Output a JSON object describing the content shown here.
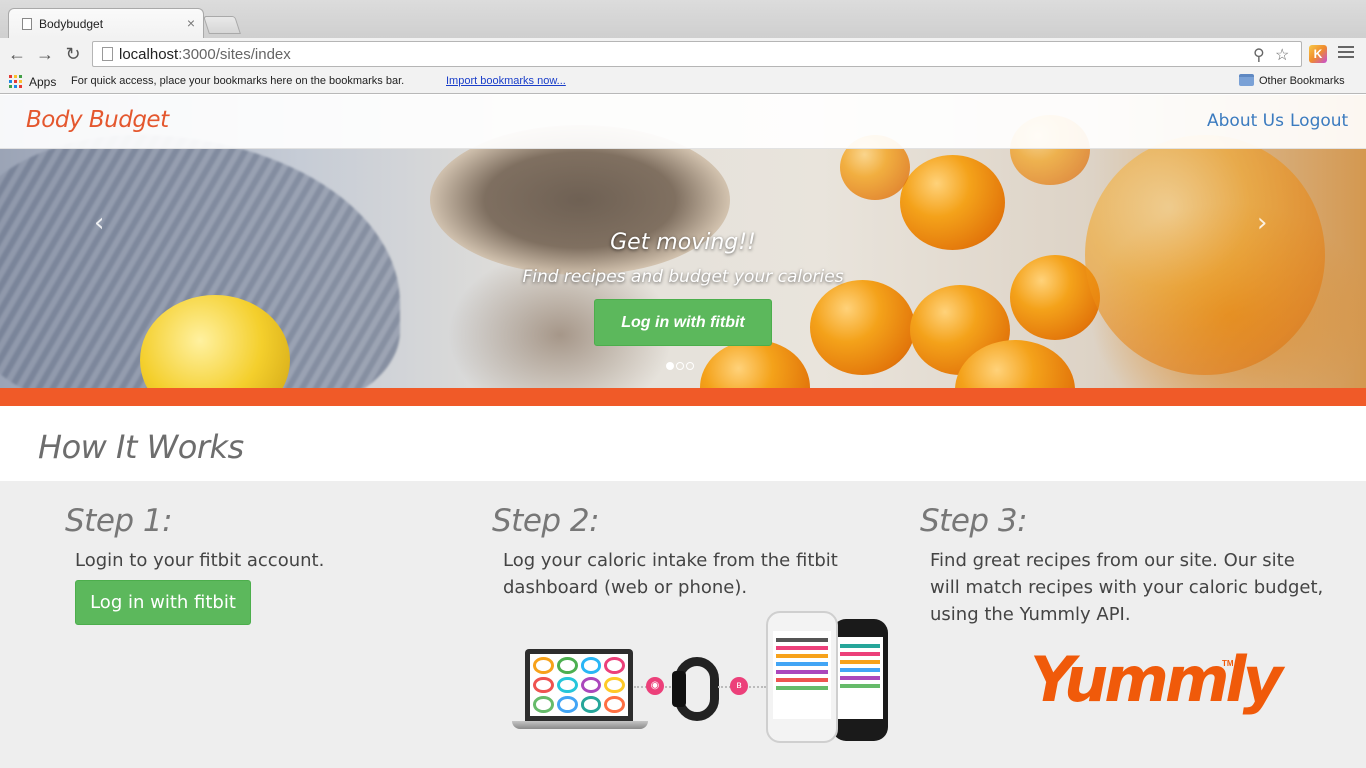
{
  "browser": {
    "tab_title": "Bodybudget",
    "tab_close": "×",
    "url_host": "localhost",
    "url_path": ":3000/sites/index",
    "bookmarks": {
      "apps_label": "Apps",
      "hint": "For quick access, place your bookmarks here on the bookmarks bar.",
      "import_link": "Import bookmarks now...",
      "other": "Other Bookmarks"
    },
    "extension_letter": "K"
  },
  "site": {
    "brand": "Body Budget",
    "nav": [
      "About Us",
      "Logout"
    ],
    "hero": {
      "title": "Get moving!!",
      "subtitle": "Find recipes and budget your calories",
      "button": "Log in with fitbit",
      "slides": 3,
      "active_slide": 1,
      "prev_arrow": "‹",
      "next_arrow": "›"
    },
    "accent_color": "#f05a28",
    "how_it_works": {
      "title": "How It Works",
      "steps": [
        {
          "title": "Step 1:",
          "text": "Login to your fitbit account.",
          "button": "Log in with fitbit"
        },
        {
          "title": "Step 2:",
          "text": "Log your caloric intake from the fitbit dashboard (web or phone)."
        },
        {
          "title": "Step 3:",
          "text": "Find great recipes from our site. Our site will match recipes with your caloric budget, using the Yummly API."
        }
      ],
      "yummly_logo": "Yummly",
      "yummly_tm": "TM"
    }
  }
}
